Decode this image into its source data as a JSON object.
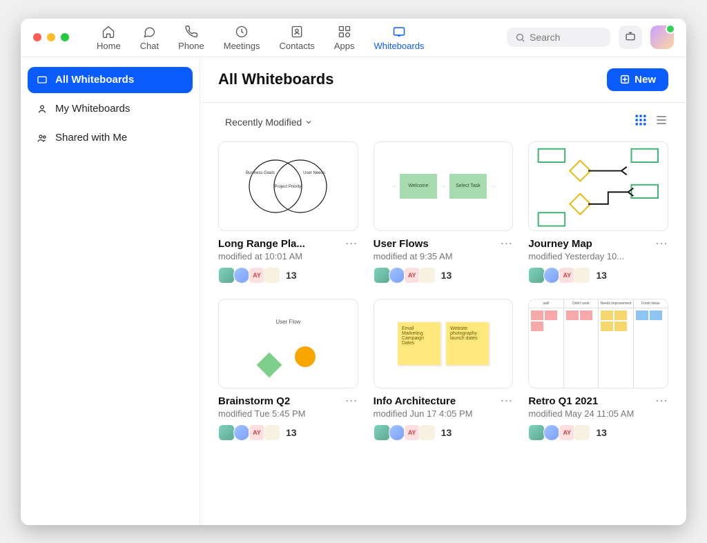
{
  "nav": {
    "home": "Home",
    "chat": "Chat",
    "phone": "Phone",
    "meetings": "Meetings",
    "contacts": "Contacts",
    "apps": "Apps",
    "whiteboards": "Whiteboards"
  },
  "search_placeholder": "Search",
  "sidebar": {
    "all": "All Whiteboards",
    "my": "My Whiteboards",
    "shared": "Shared with Me"
  },
  "page_title": "All Whiteboards",
  "new_button": "New",
  "sort_label": "Recently Modified",
  "avatar_initials": "AY",
  "cards": [
    {
      "title": "Long Range Pla...",
      "subtitle": "modified at 10:01 AM",
      "count": "13",
      "thumb_labels": [
        "Business Goals",
        "User Needs",
        "Project Priority"
      ]
    },
    {
      "title": "User Flows",
      "subtitle": "modified at 9:35 AM",
      "count": "13",
      "thumb_labels": [
        "Welcome",
        "Select Task"
      ]
    },
    {
      "title": "Journey Map",
      "subtitle": "modified Yesterday 10...",
      "count": "13"
    },
    {
      "title": "Brainstorm Q2",
      "subtitle": "modified Tue 5:45 PM",
      "count": "13",
      "thumb_labels": [
        "User Flow"
      ]
    },
    {
      "title": "Info Architecture",
      "subtitle": "modified Jun 17 4:05 PM",
      "count": "13",
      "thumb_labels": [
        "Email Marketing Campaign Dates",
        "Website photography launch dates"
      ]
    },
    {
      "title": "Retro Q1 2021",
      "subtitle": "modified May 24 11:05 AM",
      "count": "13",
      "thumb_labels": [
        "well",
        "Didn't work",
        "Needs improvement",
        "Fresh Ideas"
      ]
    }
  ]
}
